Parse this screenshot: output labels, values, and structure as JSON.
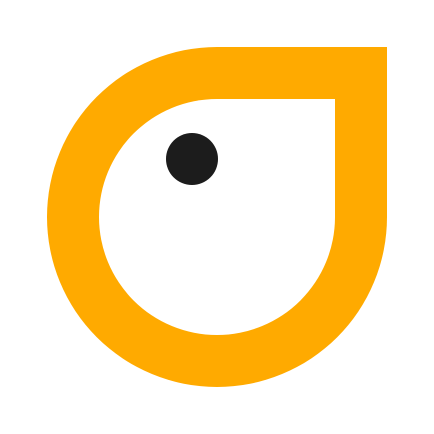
{
  "logo": {
    "name": "teardrop-eye-logo",
    "colors": {
      "ring": "#FFAA00",
      "inner": "#FFFFFF",
      "eye": "#1C1C1C",
      "background": "#FFFFFF"
    }
  }
}
